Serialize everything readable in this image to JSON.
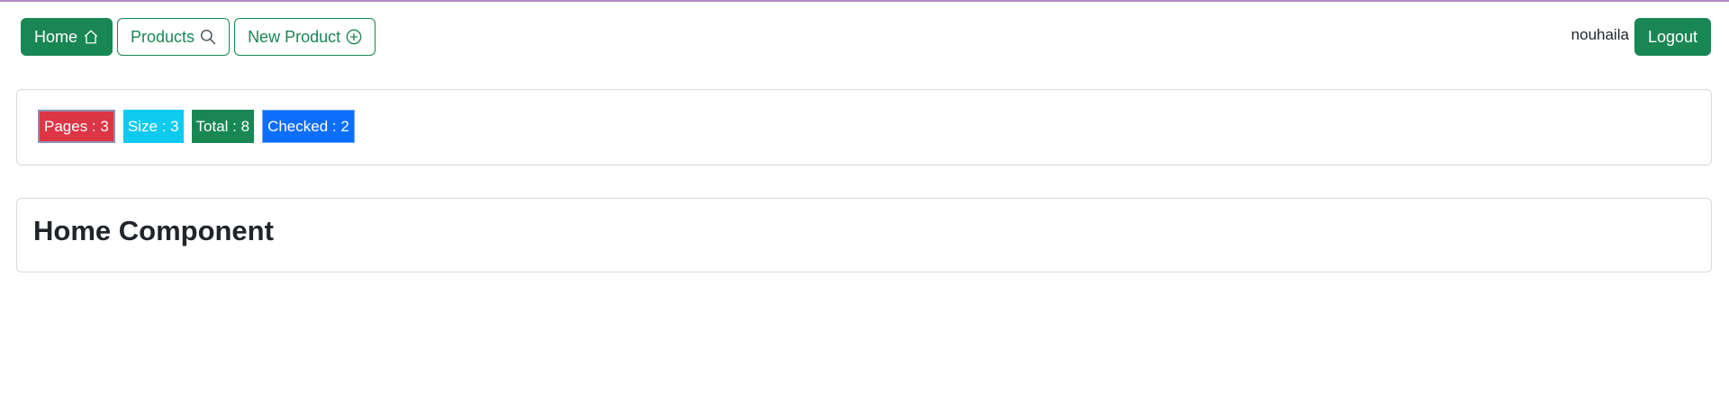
{
  "nav": {
    "home_label": "Home",
    "home_icon": "house-icon",
    "products_label": "Products",
    "products_icon": "search-icon",
    "new_product_label": "New Product",
    "new_product_icon": "plus-circle-icon",
    "username": "nouhaila",
    "logout_label": "Logout"
  },
  "stats": {
    "pages": "Pages : 3",
    "size": "Size : 3",
    "total": "Total : 8",
    "checked": "Checked : 2"
  },
  "main": {
    "title": "Home Component"
  },
  "colors": {
    "primary_green": "#198754",
    "danger": "#dc3545",
    "info": "#0dcaf0",
    "blue": "#0d6efd",
    "top_line": "#b58ac7"
  }
}
